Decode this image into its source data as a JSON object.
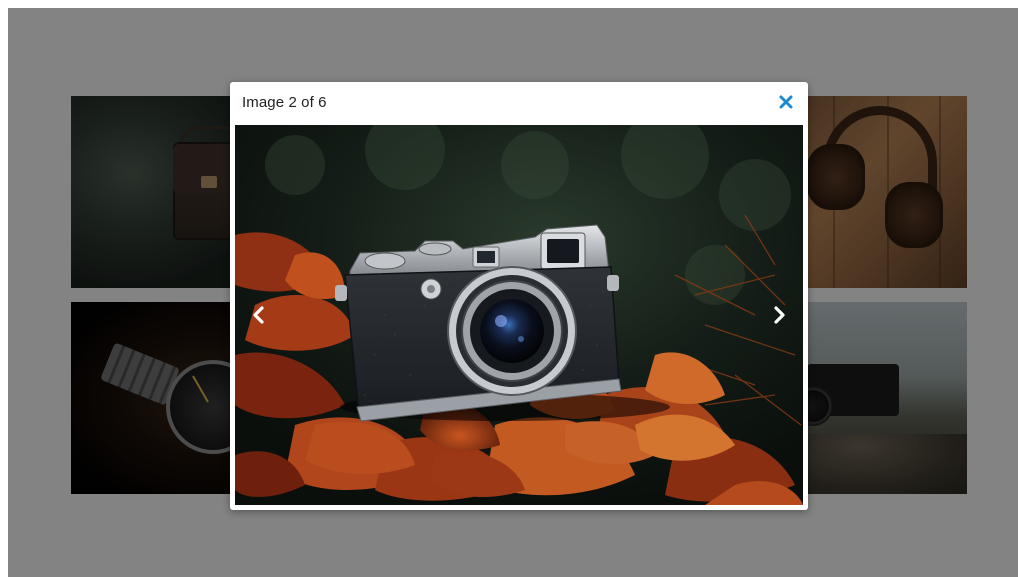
{
  "lightbox": {
    "counter_label": "Image 2 of 6",
    "close_icon": "close-icon",
    "prev_icon": "chevron-left-icon",
    "next_icon": "chevron-right-icon",
    "current_index": 2,
    "total_images": 6
  },
  "gallery": {
    "thumbnails": [
      "backpack",
      "wristwatch",
      "headphones",
      "camera"
    ]
  },
  "colors": {
    "overlay": "#000000",
    "close_icon": "#1e88d2",
    "modal_bg": "#ffffff",
    "arrow": "#ffffff"
  }
}
